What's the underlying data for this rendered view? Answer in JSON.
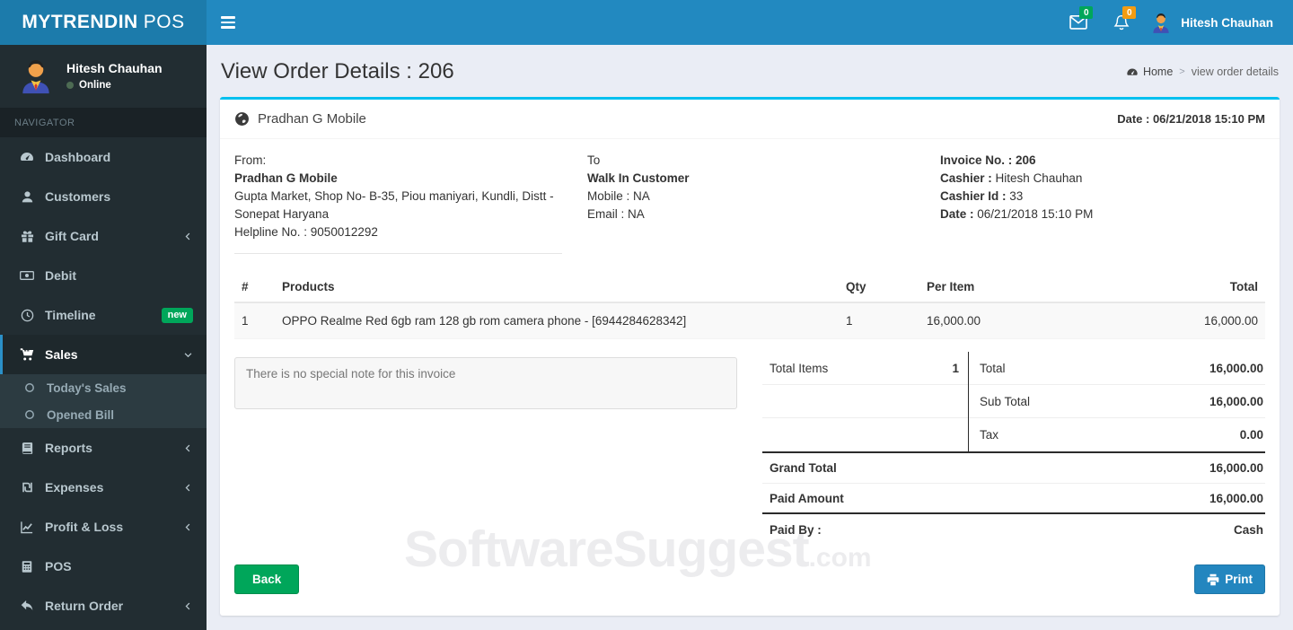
{
  "app": {
    "logo_bold": "MYTRENDIN",
    "logo_light": "POS"
  },
  "topbar": {
    "mail_badge": "0",
    "bell_badge": "0",
    "user_name": "Hitesh Chauhan"
  },
  "sidebar": {
    "user": {
      "name": "Hitesh Chauhan",
      "status": "Online"
    },
    "section_label": "NAVIGATOR",
    "new_badge": "new",
    "items": [
      {
        "label": "Dashboard"
      },
      {
        "label": "Customers"
      },
      {
        "label": "Gift Card"
      },
      {
        "label": "Debit"
      },
      {
        "label": "Timeline"
      },
      {
        "label": "Sales"
      },
      {
        "label": "Reports"
      },
      {
        "label": "Expenses"
      },
      {
        "label": "Profit & Loss"
      },
      {
        "label": "POS"
      },
      {
        "label": "Return Order"
      }
    ],
    "submenu": [
      {
        "label": "Today's Sales"
      },
      {
        "label": "Opened Bill"
      }
    ]
  },
  "page": {
    "title": "View Order Details : 206",
    "breadcrumb_home": "Home",
    "breadcrumb_sep": ">",
    "breadcrumb_current": "view order details"
  },
  "invoice": {
    "store_name": "Pradhan G Mobile",
    "header_date": "Date : 06/21/2018 15:10 PM",
    "from": {
      "label": "From:",
      "name": "Pradhan G Mobile",
      "address": "Gupta Market, Shop No- B-35, Piou maniyari, Kundli, Distt - Sonepat Haryana",
      "helpline": "Helpline No. : 9050012292"
    },
    "to": {
      "label": "To",
      "name": "Walk In Customer",
      "mobile": "Mobile : NA",
      "email": "Email : NA"
    },
    "meta": {
      "invoice_no": "Invoice No. : 206",
      "cashier_label": "Cashier :",
      "cashier_value": "Hitesh Chauhan",
      "cashier_id_label": "Cashier Id :",
      "cashier_id_value": "33",
      "date_label": "Date :",
      "date_value": "06/21/2018 15:10 PM"
    },
    "table": {
      "headers": [
        "#",
        "Products",
        "Qty",
        "Per Item",
        "Total"
      ],
      "rows": [
        {
          "sno": "1",
          "product": "OPPO Realme Red 6gb ram 128 gb rom camera phone - [6944284628342]",
          "qty": "1",
          "per_item": "16,000.00",
          "total": "16,000.00"
        }
      ]
    },
    "note": "There is no special note for this invoice",
    "totals": {
      "total_items_label": "Total Items",
      "total_items_value": "1",
      "rows": [
        {
          "label": "Total",
          "value": "16,000.00"
        },
        {
          "label": "Sub Total",
          "value": "16,000.00"
        },
        {
          "label": "Tax",
          "value": "0.00"
        }
      ],
      "grand_total_label": "Grand Total",
      "grand_total_value": "16,000.00",
      "paid_amount_label": "Paid Amount",
      "paid_amount_value": "16,000.00",
      "paid_by_label": "Paid By :",
      "paid_by_value": "Cash"
    },
    "buttons": {
      "back": "Back",
      "print": "Print"
    }
  },
  "watermark": {
    "main": "SoftwareSuggest",
    "suffix": ".com"
  },
  "colors": {
    "navbar": "#2289c0",
    "logo_bg": "#1c7bab",
    "sidebar_bg": "#222d32",
    "card_accent": "#00c0ef",
    "green": "#00a65a",
    "orange": "#f39c12",
    "print_blue": "#2386bf"
  }
}
